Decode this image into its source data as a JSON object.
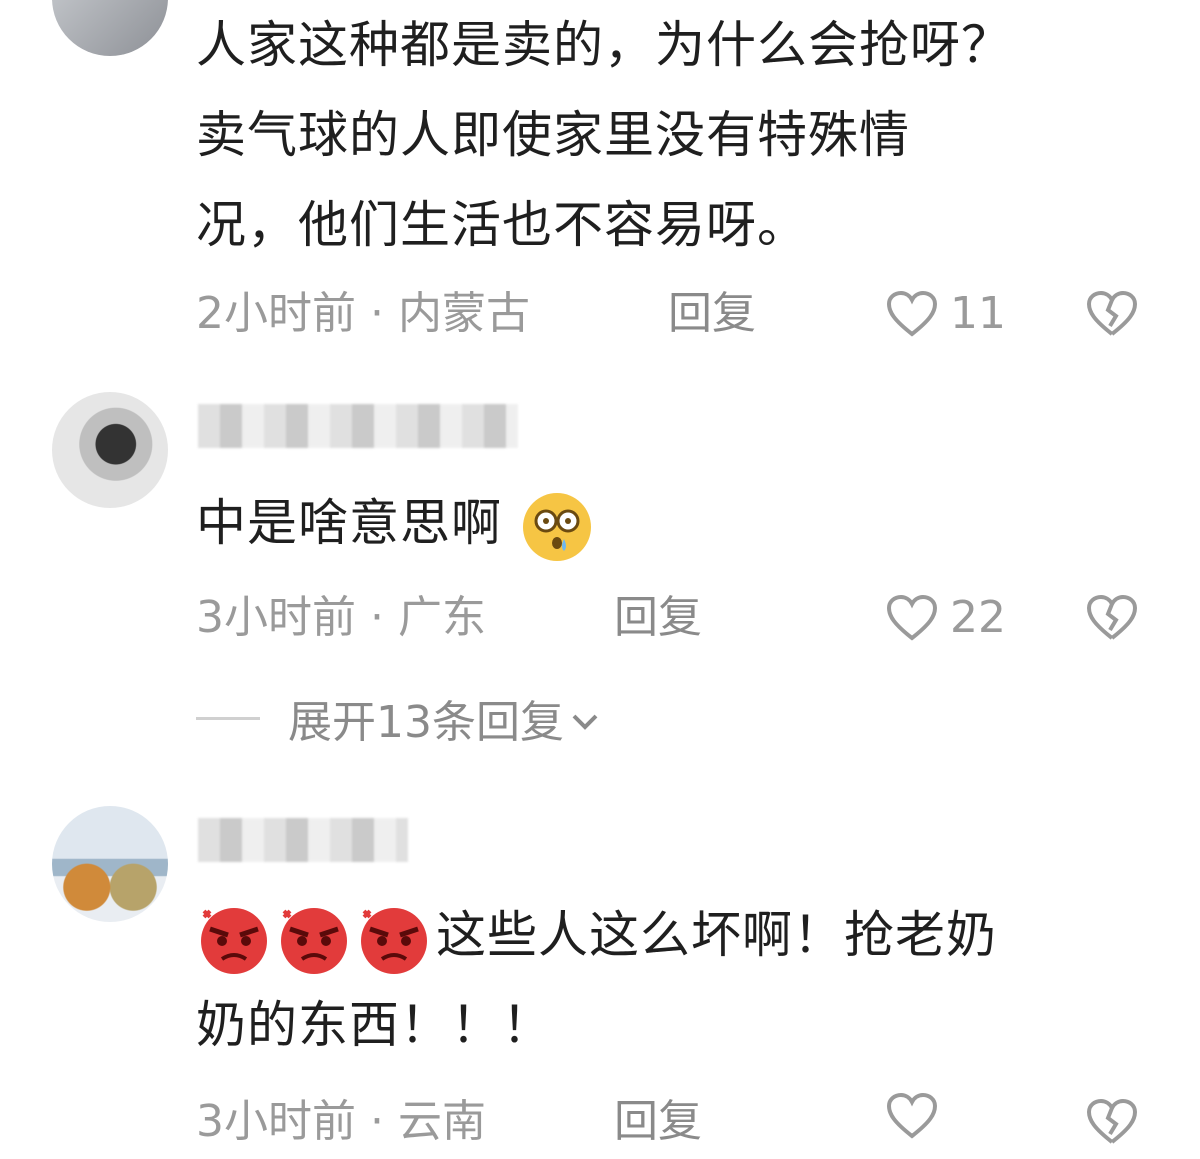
{
  "comments": [
    {
      "text_lines": [
        "人家这种都是卖的，为什么会抢呀？",
        "卖气球的人即使家里没有特殊情",
        "况，他们生活也不容易呀。"
      ],
      "time": "2小时前 · 内蒙古",
      "reply": "回复",
      "likes": "11"
    },
    {
      "text": "中是啥意思啊",
      "time": "3小时前 · 广东",
      "reply": "回复",
      "likes": "22",
      "expand": "展开13条回复"
    },
    {
      "text_lines": [
        "这些人这么坏啊！抢老奶",
        "奶的东西！！！"
      ],
      "time": "3小时前 · 云南",
      "reply": "回复"
    }
  ],
  "icons": {
    "like": "heart-icon",
    "dislike": "broken-heart-icon",
    "emoji_shock": "shocked-face-icon",
    "emoji_angry": "angry-face-icon",
    "expand": "chevron-down-icon"
  },
  "colors": {
    "text": "#1f1f1f",
    "meta": "#9a9a9a",
    "angry": "#e23b3b",
    "shock": "#f6c544"
  }
}
